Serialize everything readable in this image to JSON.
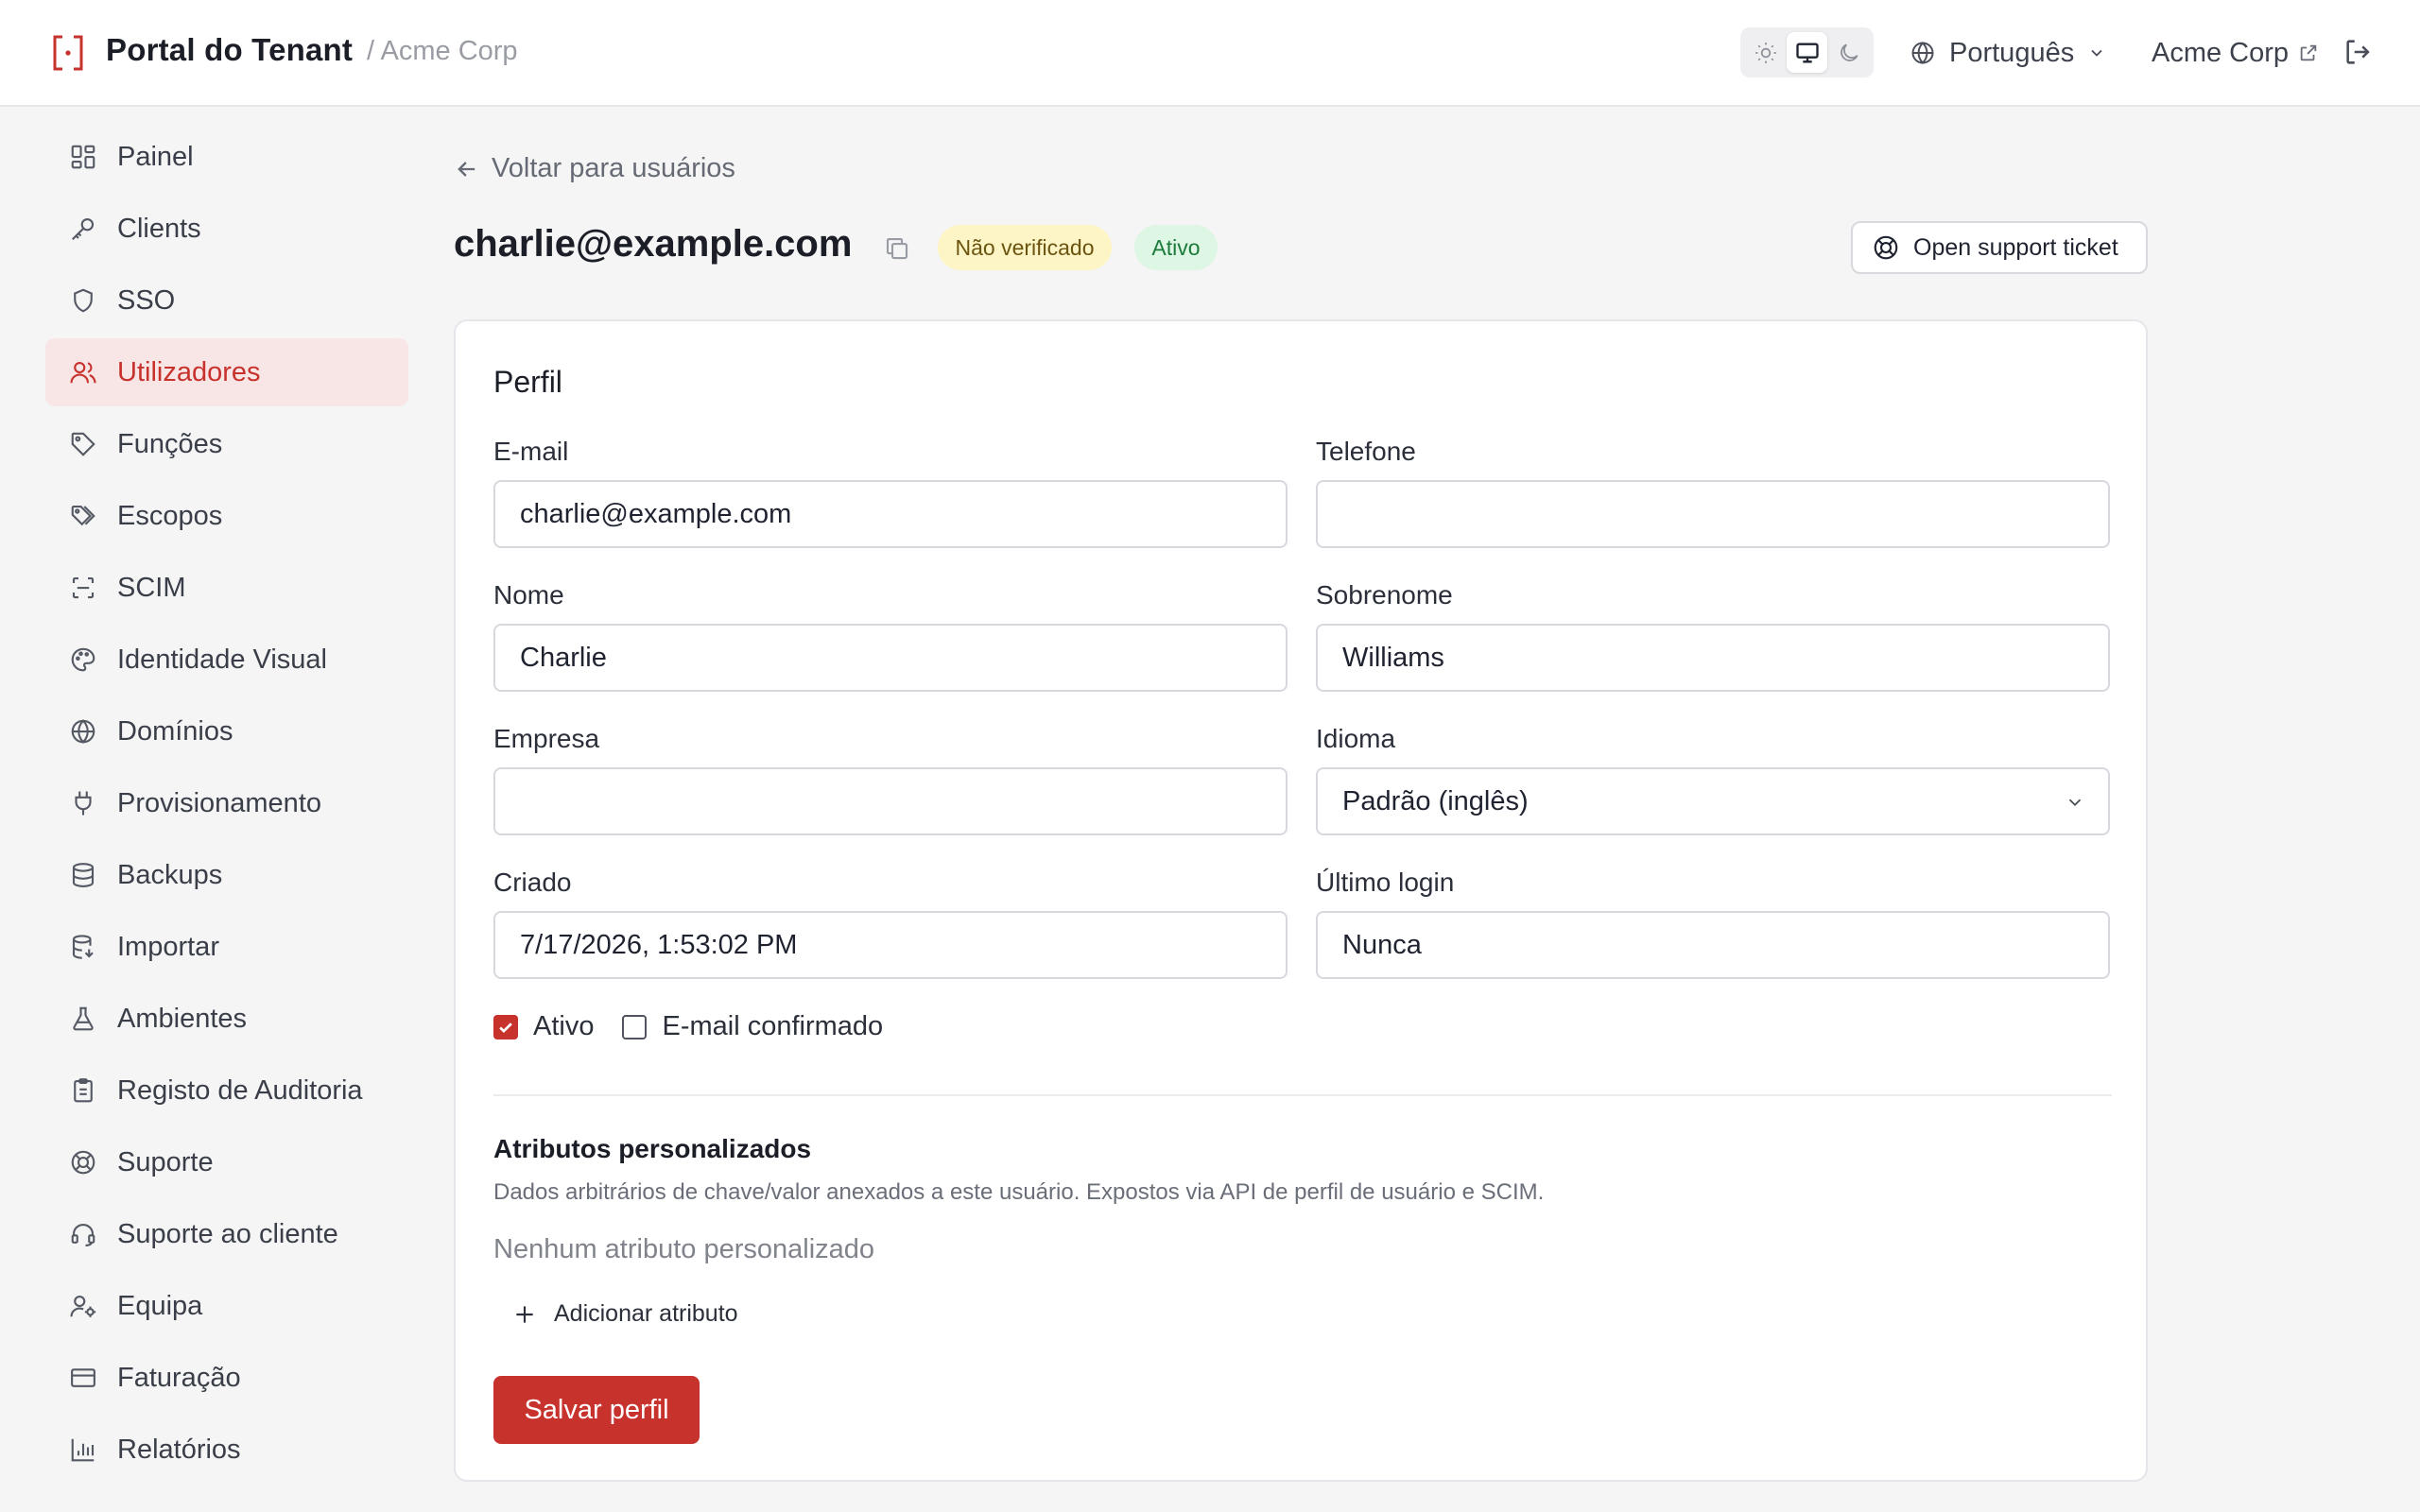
{
  "header": {
    "app_title": "Portal do Tenant",
    "tenant_breadcrumb": "/ Acme Corp",
    "theme_options": [
      "light-icon",
      "monitor-icon",
      "moon-icon"
    ],
    "theme_selected": "system",
    "language": "Português",
    "tenant_link": "Acme Corp"
  },
  "sidebar": {
    "items": [
      {
        "label": "Painel",
        "icon": "dashboard-icon",
        "active": false
      },
      {
        "label": "Clients",
        "icon": "key-icon",
        "active": false
      },
      {
        "label": "SSO",
        "icon": "shield-icon",
        "active": false
      },
      {
        "label": "Utilizadores",
        "icon": "users-icon",
        "active": true
      },
      {
        "label": "Funções",
        "icon": "tag-icon",
        "active": false
      },
      {
        "label": "Escopos",
        "icon": "tags-icon",
        "active": false
      },
      {
        "label": "SCIM",
        "icon": "scan-icon",
        "active": false
      },
      {
        "label": "Identidade Visual",
        "icon": "palette-icon",
        "active": false
      },
      {
        "label": "Domínios",
        "icon": "globe-icon",
        "active": false
      },
      {
        "label": "Provisionamento",
        "icon": "plug-icon",
        "active": false
      },
      {
        "label": "Backups",
        "icon": "database-icon",
        "active": false
      },
      {
        "label": "Importar",
        "icon": "database-import-icon",
        "active": false
      },
      {
        "label": "Ambientes",
        "icon": "flask-icon",
        "active": false
      },
      {
        "label": "Registo de Auditoria",
        "icon": "clipboard-icon",
        "active": false
      },
      {
        "label": "Suporte",
        "icon": "lifebuoy-icon",
        "active": false
      },
      {
        "label": "Suporte ao cliente",
        "icon": "headset-icon",
        "active": false
      },
      {
        "label": "Equipa",
        "icon": "user-cog-icon",
        "active": false
      },
      {
        "label": "Faturação",
        "icon": "credit-card-icon",
        "active": false
      },
      {
        "label": "Relatórios",
        "icon": "bar-chart-icon",
        "active": false
      }
    ]
  },
  "main": {
    "back_label": "Voltar para usuários",
    "user_email": "charlie@example.com",
    "badge_unverified": "Não verificado",
    "badge_active": "Ativo",
    "support_button": "Open support ticket",
    "profile": {
      "title": "Perfil",
      "email_label": "E-mail",
      "email_value": "charlie@example.com",
      "phone_label": "Telefone",
      "phone_value": "",
      "first_name_label": "Nome",
      "first_name_value": "Charlie",
      "last_name_label": "Sobrenome",
      "last_name_value": "Williams",
      "company_label": "Empresa",
      "company_value": "",
      "language_label": "Idioma",
      "language_value": "Padrão (inglês)",
      "created_label": "Criado",
      "created_value": "7/17/2026, 1:53:02 PM",
      "last_login_label": "Último login",
      "last_login_value": "Nunca",
      "active_checkbox_label": "Ativo",
      "active_checked": true,
      "email_confirmed_label": "E-mail confirmado",
      "email_confirmed_checked": false
    },
    "custom_attributes": {
      "title": "Atributos personalizados",
      "description": "Dados arbitrários de chave/valor anexados a este usuário. Expostos via API de perfil de usuário e SCIM.",
      "empty_text": "Nenhum atributo personalizado",
      "add_button": "Adicionar atributo"
    },
    "save_button": "Salvar perfil"
  },
  "colors": {
    "accent": "#c8322d",
    "active_nav_bg": "#f8e5e5",
    "badge_unverified_bg": "#fdf5c6",
    "badge_active_bg": "#def6e4"
  }
}
